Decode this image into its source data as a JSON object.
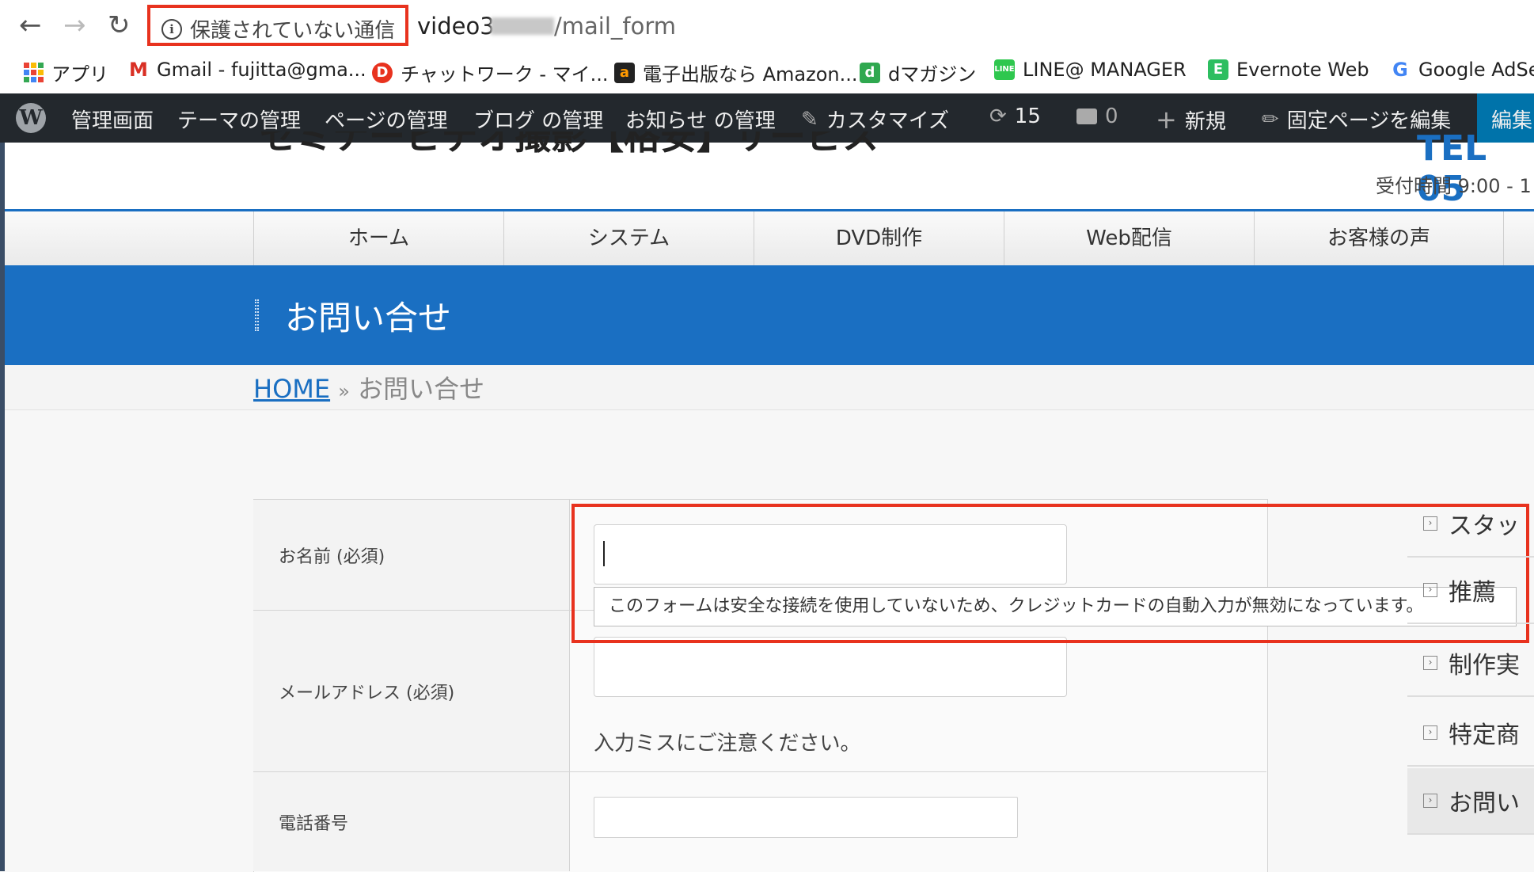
{
  "browser": {
    "back_icon": "←",
    "forward_icon": "→",
    "reload_icon": "↻",
    "security_label": "保護されていない通信",
    "url_host": "video3",
    "url_path": "/mail_form"
  },
  "bookmarks": [
    {
      "icon": "apps-grid-icon",
      "label": "アプリ"
    },
    {
      "icon": "gmail-icon",
      "label": "Gmail - fujitta@gma..."
    },
    {
      "icon": "chatwork-icon",
      "label": "チャットワーク - マイ..."
    },
    {
      "icon": "amazon-icon",
      "label": "電子出版なら Amazon..."
    },
    {
      "icon": "dmagazine-icon",
      "label": "dマガジン"
    },
    {
      "icon": "line-icon",
      "label": "LINE@ MANAGER"
    },
    {
      "icon": "evernote-icon",
      "label": "Evernote Web"
    },
    {
      "icon": "google-icon",
      "label": "Google AdSe"
    }
  ],
  "admin_bar": {
    "items": [
      "管理画面",
      "テーマの管理",
      "ページの管理",
      "ブログ の管理",
      "お知らせ の管理"
    ],
    "customize": "カスタマイズ",
    "updates_count": "15",
    "comments_count": "0",
    "new_label": "新規",
    "edit_page": "固定ページを編集",
    "edit_short": "編集"
  },
  "site": {
    "title_remnant": "セミナービデオ撮影【格安】サービス",
    "tel": "TEL 05",
    "hours": "受付時間 9:00 - 1"
  },
  "nav": [
    "ホーム",
    "システム",
    "DVD制作",
    "Web配信",
    "お客様の声"
  ],
  "page": {
    "title": "お問い合せ",
    "breadcrumb_home": "HOME",
    "breadcrumb_sep": "»",
    "breadcrumb_current": "お問い合せ"
  },
  "form": {
    "name_label": "お名前 (必須)",
    "email_label": "メールアドレス (必須)",
    "phone_label": "電話番号",
    "autofill_warning": "このフォームは安全な接続を使用していないため、クレジットカードの自動入力が無効になっています。",
    "email_note": "入力ミスにご注意ください。"
  },
  "sidebar": [
    "スタッ",
    "推薦",
    "制作実",
    "特定商",
    "お問い"
  ],
  "colors": {
    "accent": "#1a6fc2",
    "highlight": "#e8321e",
    "adminbar": "#23282d"
  }
}
